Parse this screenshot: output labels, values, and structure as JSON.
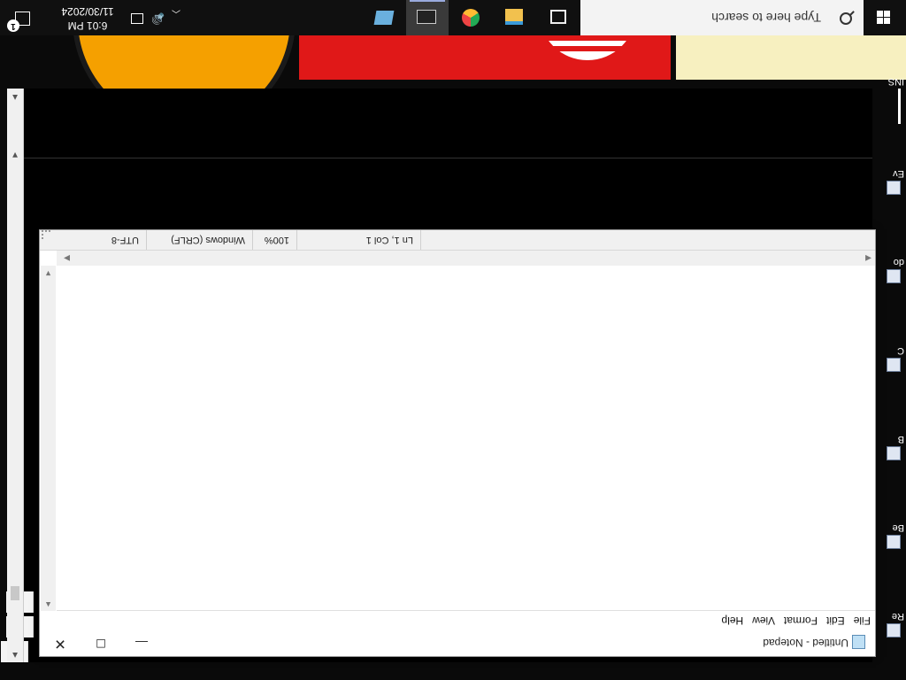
{
  "desktop": {
    "icons": [
      {
        "label": "Re"
      },
      {
        "label": "Be"
      },
      {
        "label": "B"
      },
      {
        "label": "C"
      },
      {
        "label": "do"
      },
      {
        "label": "Ev"
      },
      {
        "label": "INS"
      }
    ]
  },
  "notepad": {
    "title": "Untitled - Notepad",
    "menu": [
      "File",
      "Edit",
      "Format",
      "View",
      "Help"
    ],
    "content": "",
    "status": {
      "position": "Ln 1, Col 1",
      "zoom": "100%",
      "line_ending": "Windows (CRLF)",
      "encoding": "UTF-8"
    }
  },
  "taskbar": {
    "search_placeholder": "Type here to search",
    "apps": [
      {
        "name": "task-view"
      },
      {
        "name": "file-explorer"
      },
      {
        "name": "chrome"
      },
      {
        "name": "terminal",
        "active": true
      },
      {
        "name": "snipping"
      }
    ],
    "clock": {
      "time": "6:01 PM",
      "date": "11/30/2024"
    },
    "notification_count": "1"
  },
  "colors": {
    "accent": "#0078d7",
    "taskbar": "#101010"
  }
}
